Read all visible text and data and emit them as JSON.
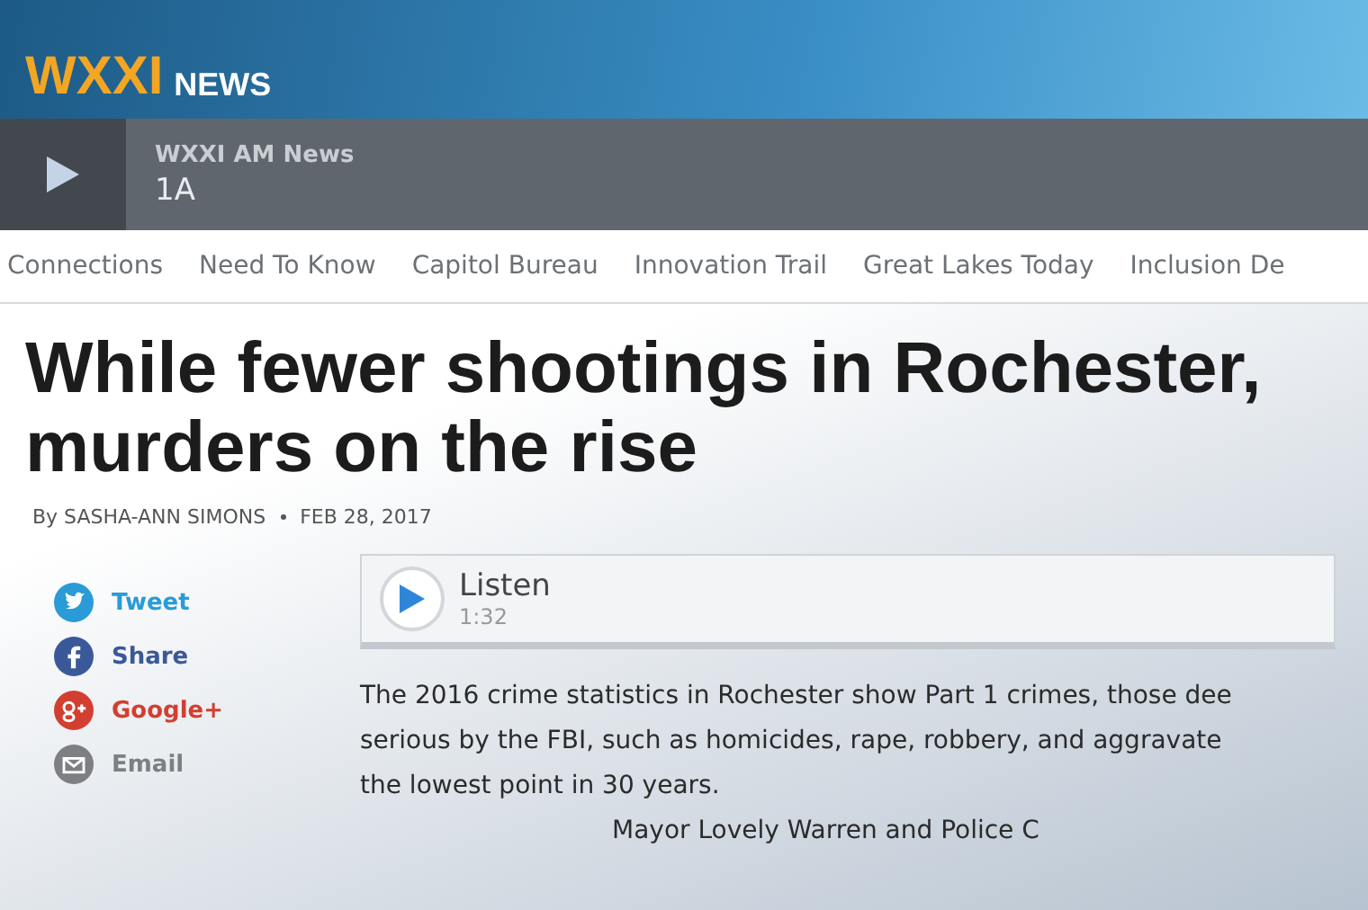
{
  "header": {
    "logo_mark": "WXXI",
    "logo_word": "NEWS"
  },
  "player": {
    "station": "WXXI AM News",
    "program": "1A"
  },
  "nav": {
    "items": [
      {
        "label": "Connections"
      },
      {
        "label": "Need To Know"
      },
      {
        "label": "Capitol Bureau"
      },
      {
        "label": "Innovation Trail"
      },
      {
        "label": "Great Lakes Today"
      },
      {
        "label": "Inclusion De"
      }
    ]
  },
  "article": {
    "headline_lines": [
      "While fewer shootings in Rochester,",
      "murders on the rise"
    ],
    "byline": "By SASHA-ANN SIMONS",
    "date": "FEB 28, 2017",
    "share": [
      {
        "kind": "twitter",
        "label": "Tweet",
        "color": "#2a9bd6"
      },
      {
        "kind": "facebook",
        "label": "Share",
        "color": "#3b5998"
      },
      {
        "kind": "google",
        "label": "Google+",
        "color": "#d23f31"
      },
      {
        "kind": "email",
        "label": "Email",
        "color": "#7d7f82"
      }
    ],
    "listen": {
      "label": "Listen",
      "duration": "1:32"
    },
    "body_lines": [
      "The 2016 crime statistics in Rochester show Part 1 crimes, those dee",
      "serious by the FBI,  such as homicides, rape, robbery, and aggravate",
      "the lowest point in 30 years."
    ],
    "body_partial": "Mayor Lovely Warren and Police C"
  }
}
